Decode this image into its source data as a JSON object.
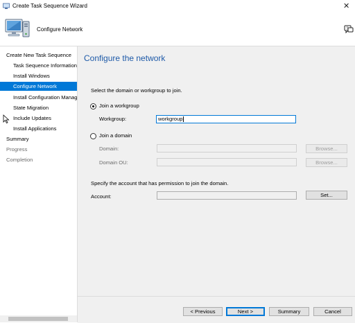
{
  "window": {
    "title": "Create Task Sequence Wizard",
    "close_glyph": "✕"
  },
  "header": {
    "title": "Configure Network"
  },
  "nav": {
    "items": [
      {
        "label": "Create New Task Sequence",
        "level": "top",
        "state": "normal"
      },
      {
        "label": "Task Sequence Information",
        "level": "sub",
        "state": "normal"
      },
      {
        "label": "Install Windows",
        "level": "sub",
        "state": "normal"
      },
      {
        "label": "Configure Network",
        "level": "sub",
        "state": "active"
      },
      {
        "label": "Install Configuration Manager",
        "level": "sub",
        "state": "normal"
      },
      {
        "label": "State Migration",
        "level": "sub",
        "state": "normal"
      },
      {
        "label": "Include Updates",
        "level": "sub",
        "state": "normal"
      },
      {
        "label": "Install Applications",
        "level": "sub",
        "state": "normal"
      },
      {
        "label": "Summary",
        "level": "top",
        "state": "normal"
      },
      {
        "label": "Progress",
        "level": "top",
        "state": "disabled"
      },
      {
        "label": "Completion",
        "level": "top",
        "state": "disabled"
      }
    ]
  },
  "main": {
    "title": "Configure the network",
    "instruction": "Select the domain or workgroup to join.",
    "workgroup_option": "Join a workgroup",
    "workgroup_label": "Workgroup:",
    "workgroup_value": "workgroup",
    "domain_option": "Join a domain",
    "domain_label": "Domain:",
    "domain_value": "",
    "domain_browse": "Browse...",
    "domain_ou_label": "Domain OU:",
    "domain_ou_value": "",
    "domain_ou_browse": "Browse...",
    "account_instruction": "Specify the account that has permission to join the domain.",
    "account_label": "Account:",
    "account_value": "",
    "set_button": "Set..."
  },
  "footer": {
    "previous": "< Previous",
    "next": "Next >",
    "summary": "Summary",
    "cancel": "Cancel"
  },
  "colors": {
    "accent": "#0078d7",
    "title_blue": "#1e5aa8",
    "panel_bg": "#f0f0f0"
  }
}
